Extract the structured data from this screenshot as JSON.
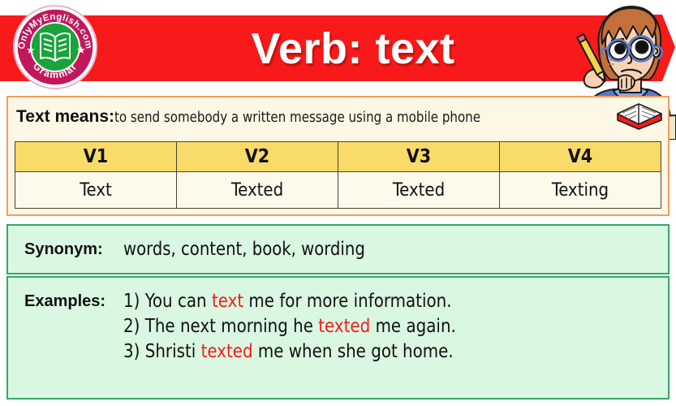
{
  "header": {
    "title": "Verb: text",
    "banner_color": "#f81a1a",
    "title_color": "#ffffff",
    "logo": {
      "top_text": "OnlyMyEnglish.com",
      "bottom_text": "Grammar",
      "icon": "open-book-icon",
      "ring_color": "#c2185b",
      "center_color": "#1aa33a"
    },
    "illustration": "thinking-boy-with-pencil-and-book"
  },
  "definition": {
    "label": "Text means:",
    "text": "to send somebody a written message using a mobile phone",
    "icon": "open-book-icon",
    "border_color": "#f79b5c",
    "background_color": "#fdf8e6"
  },
  "verb_table": {
    "headers": [
      "V1",
      "V2",
      "V3",
      "V4"
    ],
    "values": [
      "Text",
      "Texted",
      "Texted",
      "Texting"
    ],
    "header_bg": "#f9db69",
    "cell_bg": "#fdfaec",
    "border_color": "#4d4238"
  },
  "synonym": {
    "label": "Synonym:",
    "value": "words, content, book, wording",
    "border_color": "#36a862",
    "background_color": "#d9f7e1"
  },
  "examples": {
    "label": "Examples:",
    "highlight_color": "#f41c1c",
    "items": [
      {
        "number": "1)",
        "before": "You can ",
        "highlight": "text",
        "after": " me for more information."
      },
      {
        "number": "2)",
        "before": "The next morning he ",
        "highlight": "texted",
        "after": " me again."
      },
      {
        "number": "3)",
        "before": "Shristi ",
        "highlight": "texted",
        "after": " me when she got home."
      }
    ]
  }
}
